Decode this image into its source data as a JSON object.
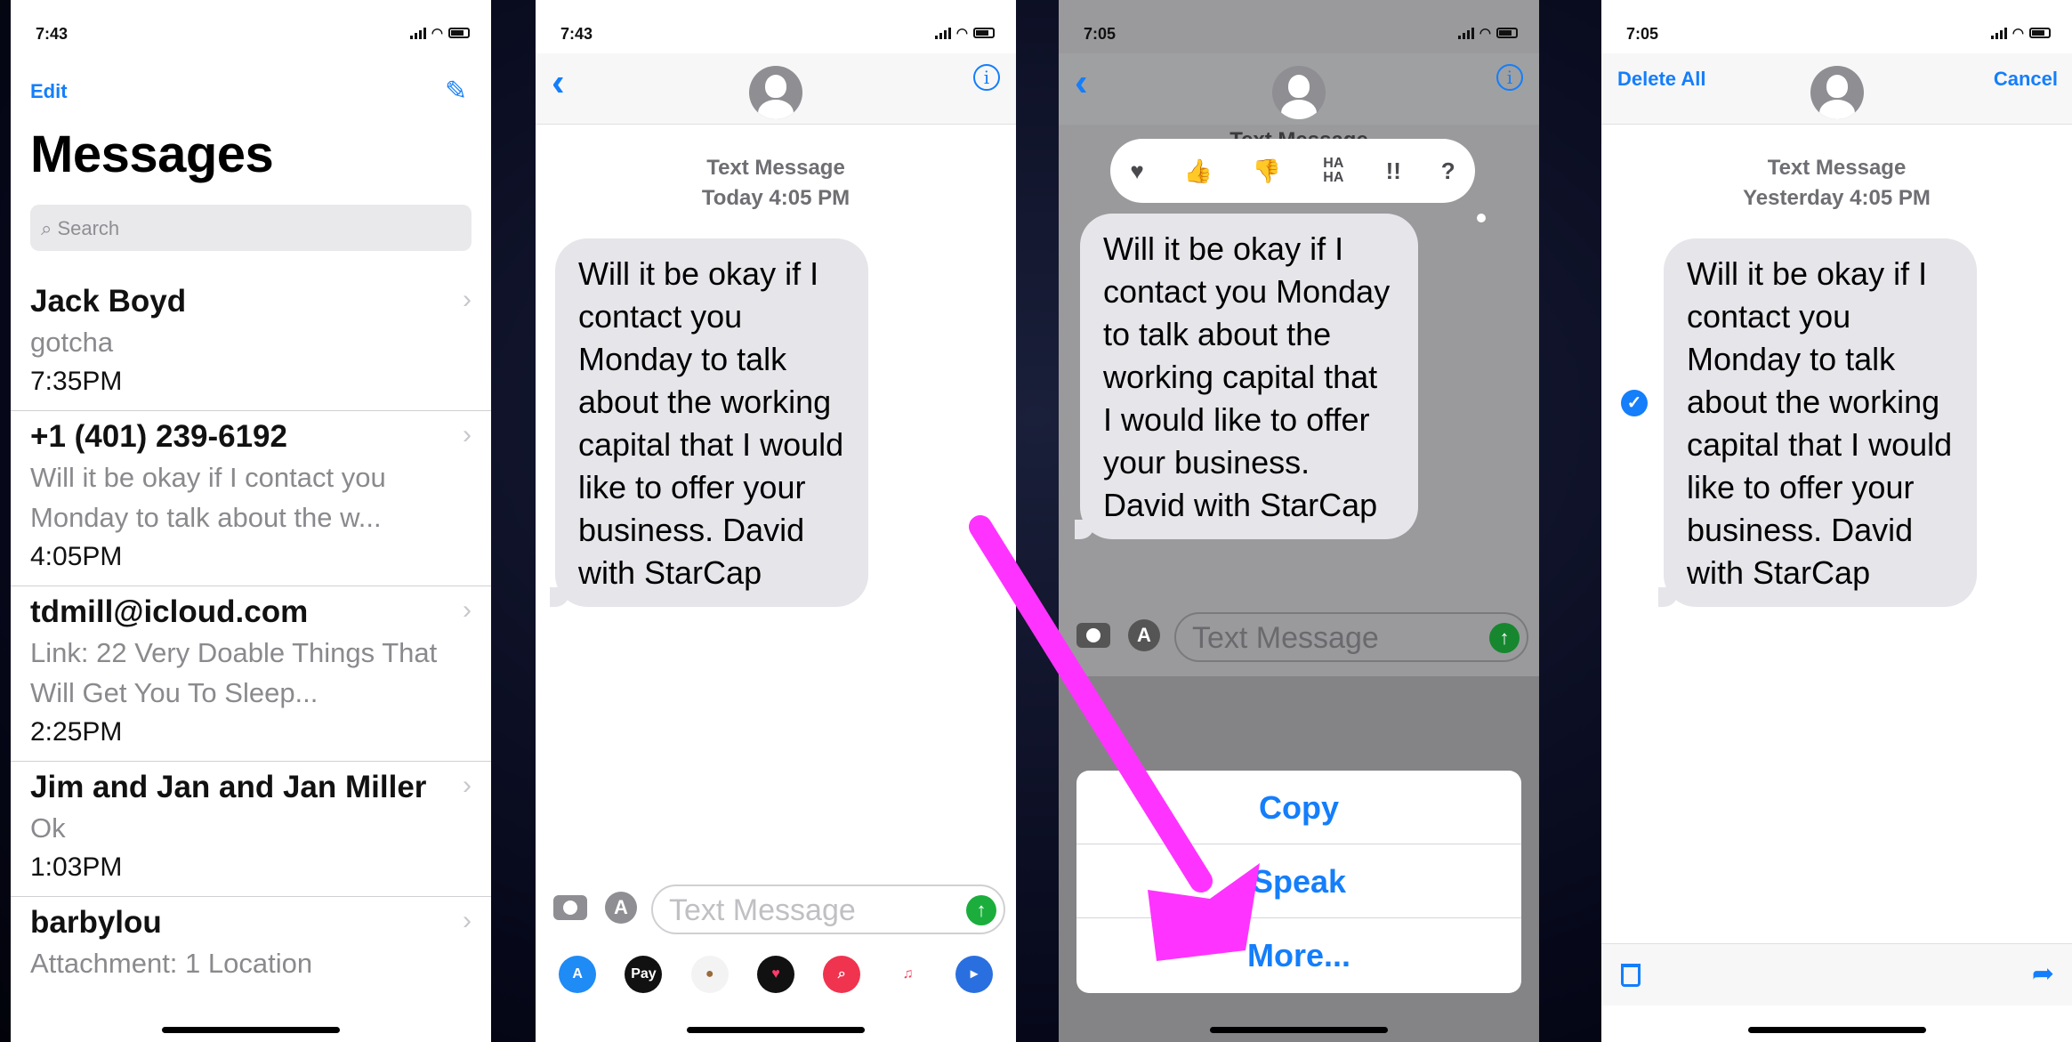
{
  "phone1": {
    "status_time": "7:43",
    "edit": "Edit",
    "title": "Messages",
    "search_placeholder": "Search",
    "conversations": [
      {
        "name": "Jack Boyd",
        "preview": "gotcha",
        "time": "7:35PM"
      },
      {
        "name": "+1 (401) 239-6192",
        "preview": "Will it be okay if I contact you Monday to talk about the w...",
        "time": "4:05PM"
      },
      {
        "name": "tdmill@icloud.com",
        "preview": "Link: 22 Very Doable Things That Will Get You To Sleep...",
        "time": "2:25PM"
      },
      {
        "name": "Jim and Jan and Jan Miller",
        "preview": "Ok",
        "time": "1:03PM"
      },
      {
        "name": "barbylou",
        "preview": "Attachment: 1 Location",
        "time": ""
      }
    ]
  },
  "phone2": {
    "status_time": "7:43",
    "meta_line1": "Text Message",
    "meta_line2": "Today 4:05 PM",
    "message": "Will it be okay if I contact you Monday to talk about the working capital that I would like to offer your business. David with StarCap",
    "input_placeholder": "Text Message",
    "apps": [
      "App Store",
      "Pay",
      "Monkey",
      "Heart",
      "Search",
      "Music",
      "Other"
    ]
  },
  "phone3": {
    "status_time": "7:05",
    "tapback_label": "Text Message",
    "tapbacks": [
      "♥",
      "👍",
      "👎",
      "HA HA",
      "!!",
      "?"
    ],
    "message": "Will it be okay if I contact you Monday to talk about the working capital that I would like to offer your business. David with StarCap",
    "input_placeholder": "Text Message",
    "actions": [
      "Copy",
      "Speak",
      "More..."
    ]
  },
  "phone4": {
    "status_time": "7:05",
    "delete_all": "Delete All",
    "cancel": "Cancel",
    "meta_line1": "Text Message",
    "meta_line2": "Yesterday 4:05 PM",
    "message": "Will it be okay if I contact you Monday to talk about the working capital that I would like to offer your business. David with StarCap"
  },
  "colors": {
    "ios_blue": "#147efb",
    "send_green": "#1cae3c",
    "arrow_magenta": "#ff33ff",
    "bubble_gray": "#e5e5ea"
  },
  "icons": {
    "compose": "compose-icon",
    "back": "chevron-left-icon",
    "info": "info-icon",
    "camera": "camera-icon",
    "appstore": "app-store-icon",
    "send": "send-arrow-icon",
    "trash": "trash-icon",
    "share": "share-icon",
    "check": "checkmark-icon"
  }
}
